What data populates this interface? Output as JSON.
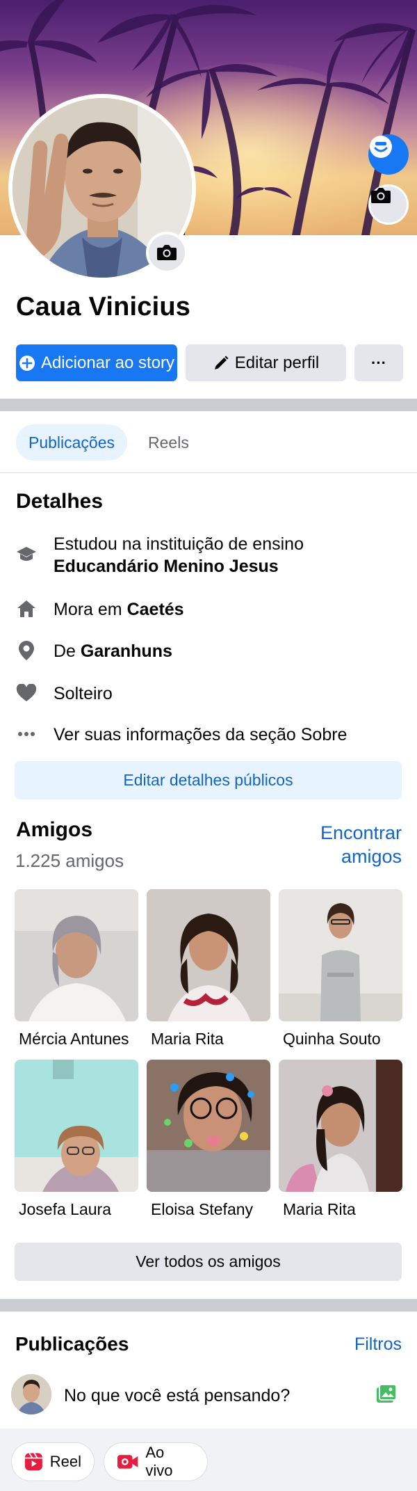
{
  "profile": {
    "name": "Caua Vinicius"
  },
  "actions": {
    "add_story": "Adicionar ao story",
    "edit_profile": "Editar perfil",
    "more": "···"
  },
  "tabs": [
    {
      "label": "Publicações",
      "active": true
    },
    {
      "label": "Reels",
      "active": false
    }
  ],
  "details": {
    "title": "Detalhes",
    "studied_prefix": "Estudou na instituição de ensino",
    "studied_school": "Educandário Menino Jesus",
    "lives_prefix": "Mora em ",
    "lives_city": "Caetés",
    "from_prefix": "De ",
    "from_city": "Garanhuns",
    "relationship": "Solteiro",
    "about_link": "Ver suas informações da seção Sobre",
    "edit_button": "Editar detalhes públicos"
  },
  "friends": {
    "title": "Amigos",
    "count": "1.225 amigos",
    "find_line1": "Encontrar",
    "find_line2": "amigos",
    "list": [
      {
        "name": "Mércia Antunes"
      },
      {
        "name": "Maria Rita"
      },
      {
        "name": "Quinha Souto"
      },
      {
        "name": "Josefa Laura"
      },
      {
        "name": "Eloisa Stefany"
      },
      {
        "name": "Maria Rita"
      }
    ],
    "see_all": "Ver todos os amigos"
  },
  "posts": {
    "title": "Publicações",
    "filters": "Filtros",
    "composer_placeholder": "No que você está pensando?",
    "reel": "Reel",
    "live": "Ao vivo"
  },
  "colors": {
    "brand_blue": "#1877f2",
    "link_blue": "#1264c8",
    "light_blue_bg": "#e7f3ff",
    "gray_btn": "#e4e6eb",
    "reel_icon": "#e41e3f"
  }
}
